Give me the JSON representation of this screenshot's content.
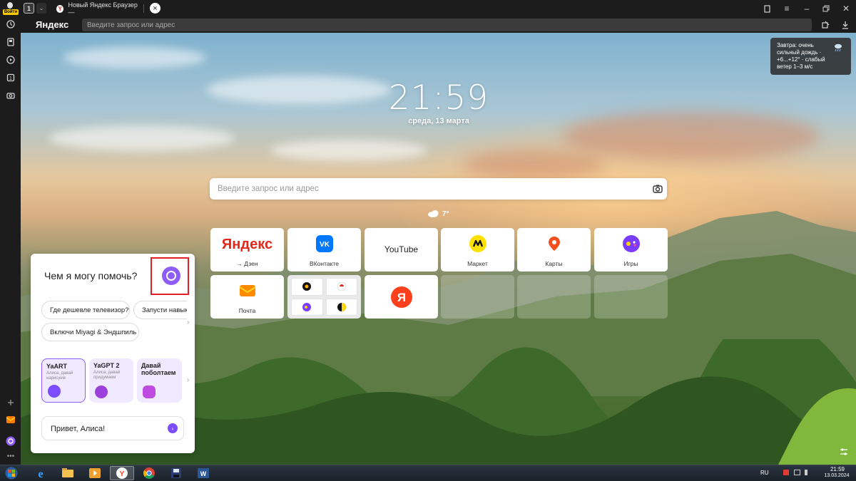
{
  "sidebar": {
    "profile_label": "Войти",
    "icons": [
      "history-icon",
      "collections-icon",
      "media-icon",
      "tabs-icon",
      "screenshot-icon",
      "add-icon",
      "mail-icon",
      "alice-icon",
      "more-icon"
    ]
  },
  "tabbar": {
    "tab_count": "1",
    "active_tab_title": "Новый Яндекс Браузер —",
    "favicon_letter": "Y",
    "new_tab_glyph": "×"
  },
  "addressbar": {
    "logo": "Яндекс",
    "placeholder": "Введите запрос или адрес"
  },
  "clock": {
    "time": "21:59",
    "date": "среда, 13 марта"
  },
  "weather_card": {
    "text": "Завтра: очень сильный дождь · +6...+12° · слабый ветер 1–3 м/с"
  },
  "search": {
    "placeholder": "Введите запрос или адрес"
  },
  "weather": {
    "temp": "7°"
  },
  "tiles": [
    {
      "name": "yandex",
      "logo": "Яндекс",
      "label": "→ Дзен"
    },
    {
      "name": "vkontakte",
      "label": "ВКонтакте"
    },
    {
      "name": "youtube",
      "logo": "YouTube",
      "label": ""
    },
    {
      "name": "market",
      "label": "Маркет"
    },
    {
      "name": "maps",
      "label": "Карты"
    },
    {
      "name": "games",
      "label": "Игры"
    },
    {
      "name": "mail",
      "label": "Почта"
    },
    {
      "name": "folder",
      "label": ""
    },
    {
      "name": "yandex-app",
      "label": ""
    }
  ],
  "alice": {
    "title": "Чем я могу помочь?",
    "chips": [
      "Где дешевле телевизор?",
      "Запусти навык",
      "Включи Miyagi & Эндшпиль"
    ],
    "cards": [
      {
        "title": "YaART",
        "subtitle": "Алиса, давай нарисуем"
      },
      {
        "title": "YaGPT 2",
        "subtitle": "Алиса, давай придумаем"
      },
      {
        "title": "Давай поболтаем",
        "subtitle": ""
      }
    ],
    "input_value": "Привет, Алиса!"
  },
  "taskbar": {
    "apps": [
      "windows-start",
      "internet-explorer",
      "file-explorer",
      "media-player",
      "yandex-browser",
      "chrome",
      "save-app",
      "word"
    ],
    "lang": "RU",
    "time": "21:59",
    "date": "13.03.2024"
  },
  "colors": {
    "yandex_red": "#e5261b",
    "alice_purple": "#8e5cf6",
    "highlight_red": "#e41e26",
    "vk_blue": "#0077ff",
    "market_yellow": "#ffe100"
  }
}
